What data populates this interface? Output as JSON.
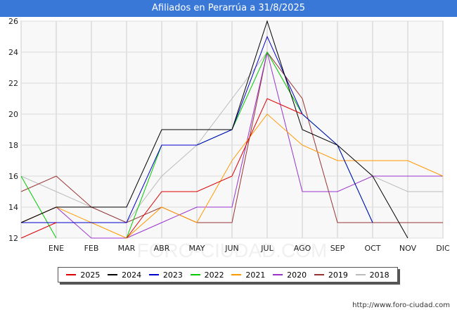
{
  "header": {
    "title": "Afiliados en Perarrúa a 31/8/2025"
  },
  "source": "http://www.foro-ciudad.com",
  "watermark": "FORO-CIUDAD.COM",
  "chart_data": {
    "type": "line",
    "title": "Afiliados en Perarrúa a 31/8/2025",
    "xlabel": "",
    "ylabel": "",
    "categories": [
      "",
      "ENE",
      "FEB",
      "MAR",
      "ABR",
      "MAY",
      "JUN",
      "JUL",
      "AGO",
      "SEP",
      "OCT",
      "NOV",
      "DIC"
    ],
    "yticks": [
      12,
      14,
      16,
      18,
      20,
      22,
      24,
      26
    ],
    "ylim": [
      12,
      26
    ],
    "grid": true,
    "legend_position": "bottom",
    "series": [
      {
        "name": "2025",
        "color": "#dd0000",
        "values": [
          12,
          13,
          null,
          12,
          15,
          15,
          16,
          21,
          20,
          null,
          null,
          null,
          null
        ]
      },
      {
        "name": "2024",
        "color": "#000000",
        "values": [
          13,
          14,
          14,
          14,
          19,
          19,
          19,
          26,
          19,
          18,
          16,
          12,
          null
        ]
      },
      {
        "name": "2023",
        "color": "#0000cc",
        "values": [
          13,
          13,
          13,
          13,
          18,
          18,
          19,
          25,
          20,
          18,
          13,
          null,
          null
        ]
      },
      {
        "name": "2022",
        "color": "#00cc00",
        "values": [
          16,
          12,
          null,
          12,
          18,
          18,
          19,
          24,
          20,
          18,
          13,
          null,
          null
        ]
      },
      {
        "name": "2021",
        "color": "#ff9900",
        "values": [
          13,
          14,
          13,
          12,
          14,
          13,
          17,
          20,
          18,
          17,
          17,
          17,
          16
        ]
      },
      {
        "name": "2020",
        "color": "#9933cc",
        "values": [
          13,
          14,
          12,
          12,
          13,
          14,
          14,
          24,
          15,
          15,
          16,
          16,
          16
        ]
      },
      {
        "name": "2019",
        "color": "#993333",
        "values": [
          15,
          16,
          14,
          13,
          14,
          13,
          13,
          24,
          21,
          13,
          13,
          13,
          13
        ]
      },
      {
        "name": "2018",
        "color": "#bbbbbb",
        "values": [
          16,
          15,
          14,
          13,
          16,
          18,
          21,
          24,
          20,
          18,
          16,
          15,
          15
        ]
      }
    ]
  }
}
